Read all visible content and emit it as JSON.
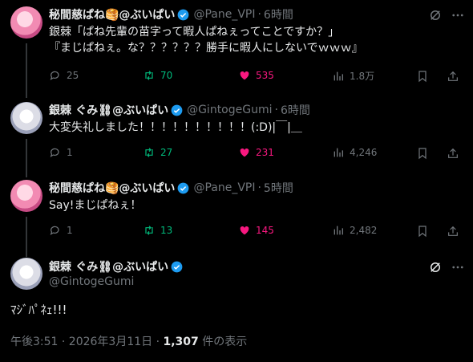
{
  "tweets": [
    {
      "name": "秘間慈ぱね🥞@ぶいぱい",
      "handle": "@Pane_VPI",
      "time": "6時間",
      "text": "銀棘「ぱね先輩の苗字って暇人ぱねぇってことですか？」\n『まじぱねぇ。な？？？？？？勝手に暇人にしないでｗｗｗ』",
      "replies": "25",
      "retweets": "70",
      "likes": "535",
      "views": "1.8万"
    },
    {
      "name": "銀棘 ぐみ⛓@ぶいぱい",
      "handle": "@GintogeGumi",
      "time": "6時間",
      "text": "大変失礼しました！！！！！！！！！！(:D)|￣|＿",
      "replies": "1",
      "retweets": "27",
      "likes": "231",
      "views": "4,246"
    },
    {
      "name": "秘間慈ぱね🥞@ぶいぱい",
      "handle": "@Pane_VPI",
      "time": "5時間",
      "text": "Say!まじぱねぇ！",
      "replies": "1",
      "retweets": "13",
      "likes": "145",
      "views": "2,482"
    }
  ],
  "main": {
    "name": "銀棘 ぐみ⛓@ぶいぱい",
    "handle": "@GintogeGumi",
    "text": "ﾏｼﾞﾊﾟﾈｪ!!!",
    "time": "午後3:51 · 2026年3月11日 · ",
    "views_count": "1,307",
    "views_label": " 件の表示"
  },
  "colors": {
    "verified": "#1d9bf0",
    "retweet": "#00ba7c",
    "like": "#f91880",
    "muted": "#71767b"
  }
}
